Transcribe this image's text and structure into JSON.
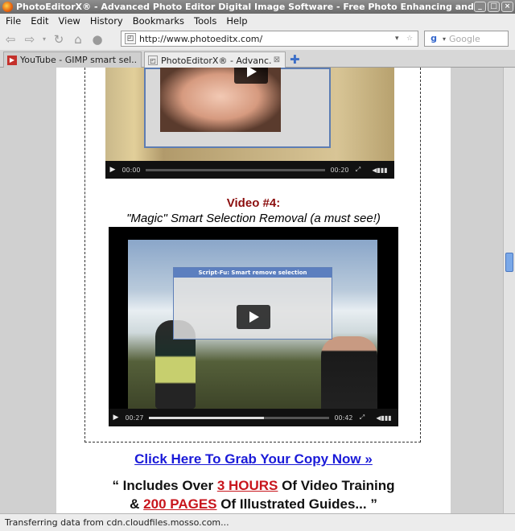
{
  "window": {
    "title": "PhotoEditorX® - Advanced Photo Editor Digital Image Software - Free Photo Enhancing and Manipul"
  },
  "menu": [
    "File",
    "Edit",
    "View",
    "History",
    "Bookmarks",
    "Tools",
    "Help"
  ],
  "navbar": {
    "url": "http://www.photoeditx.com/",
    "search_placeholder": "Google"
  },
  "tabs": [
    {
      "label": "YouTube - GIMP smart sel...",
      "active": false
    },
    {
      "label": "PhotoEditorX® - Advanc...",
      "active": true
    }
  ],
  "video1": {
    "elapsed": "00:00",
    "duration": "00:20",
    "progress": 0.0
  },
  "video4": {
    "heading": "Video #4:",
    "subtitle": "\"Magic\" Smart Selection Removal (a must see!)",
    "dialog_title": "Script-Fu: Smart remove selection",
    "elapsed": "00:27",
    "duration": "00:42",
    "progress": 0.64
  },
  "cta": {
    "label": "Click Here To Grab Your Copy Now »"
  },
  "includes": {
    "line1_pre": "“ Includes Over ",
    "line1_highlight": "3 HOURS",
    "line1_post": " Of Video Training",
    "line2_pre": "& ",
    "line2_highlight": "200 PAGES",
    "line2_post": " Of Illustrated Guides... ”"
  },
  "status": {
    "text": "Transferring data from cdn.cloudfiles.mosso.com..."
  }
}
